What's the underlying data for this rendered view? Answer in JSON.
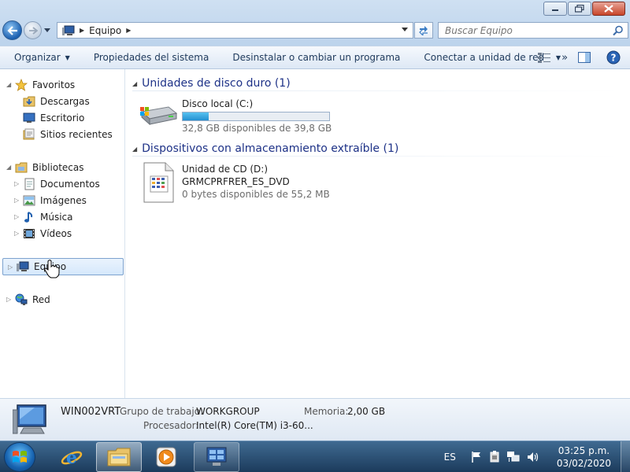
{
  "window": {
    "controls": {
      "minimize": "minimize",
      "maximize": "restore",
      "close": "close"
    }
  },
  "address": {
    "crumbs": [
      "Equipo"
    ],
    "search_placeholder": "Buscar Equipo"
  },
  "toolbar": {
    "organize": "Organizar",
    "system_properties": "Propiedades del sistema",
    "uninstall": "Desinstalar o cambiar un programa",
    "map_drive": "Conectar a unidad de red",
    "more": "»"
  },
  "nav": {
    "favorites": {
      "label": "Favoritos",
      "items": [
        "Descargas",
        "Escritorio",
        "Sitios recientes"
      ]
    },
    "libraries": {
      "label": "Bibliotecas",
      "items": [
        "Documentos",
        "Imágenes",
        "Música",
        "Vídeos"
      ]
    },
    "computer": "Equipo",
    "network": "Red"
  },
  "content": {
    "hdd_group": "Unidades de disco duro (1)",
    "local_disk": {
      "name": "Disco local (C:)",
      "free": "32,8 GB disponibles de 39,8 GB",
      "used_fraction": 0.176
    },
    "removable_group": "Dispositivos con almacenamiento extraíble (1)",
    "cd_drive": {
      "name": "Unidad de CD (D:)",
      "label": "GRMCPRFRER_ES_DVD",
      "free": "0 bytes disponibles de 55,2 MB"
    }
  },
  "details": {
    "computer_name": "WIN002VRT",
    "workgroup_label": "Grupo de trabajo:",
    "workgroup_value": "WORKGROUP",
    "memory_label": "Memoria:",
    "memory_value": "2,00 GB",
    "processor_label": "Procesador:",
    "processor_value": "Intel(R) Core(TM) i3-60..."
  },
  "taskbar": {
    "lang": "ES",
    "time": "03:25 p.m.",
    "date": "03/02/2020"
  },
  "colors": {
    "accent": "#1e3287",
    "bar_fill": "#2591d1"
  }
}
